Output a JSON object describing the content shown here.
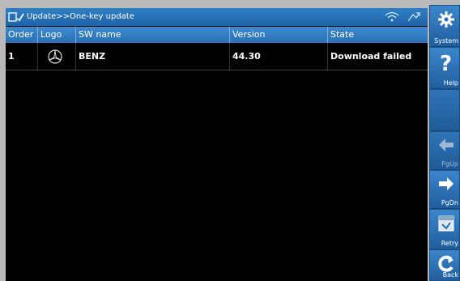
{
  "titlebar": {
    "title": "Update>>One-key update"
  },
  "table": {
    "headers": [
      "Order",
      "Logo",
      "SW name",
      "Version",
      "State"
    ],
    "rows": [
      {
        "order": "1",
        "logo": "mercedes-benz-logo",
        "sw_name": "BENZ",
        "version": "44.30",
        "state": "Download failed"
      }
    ]
  },
  "sidebar": {
    "system": "System",
    "help": "Help",
    "pgup": "PgUp",
    "pgdn": "PgDn",
    "retry": "Retry",
    "back": "Back"
  },
  "colors": {
    "titlebar": "#2a72b8",
    "table_header": "#337dc4",
    "screen_bg": "#000000",
    "frame_bg": "#b9b9b9"
  }
}
